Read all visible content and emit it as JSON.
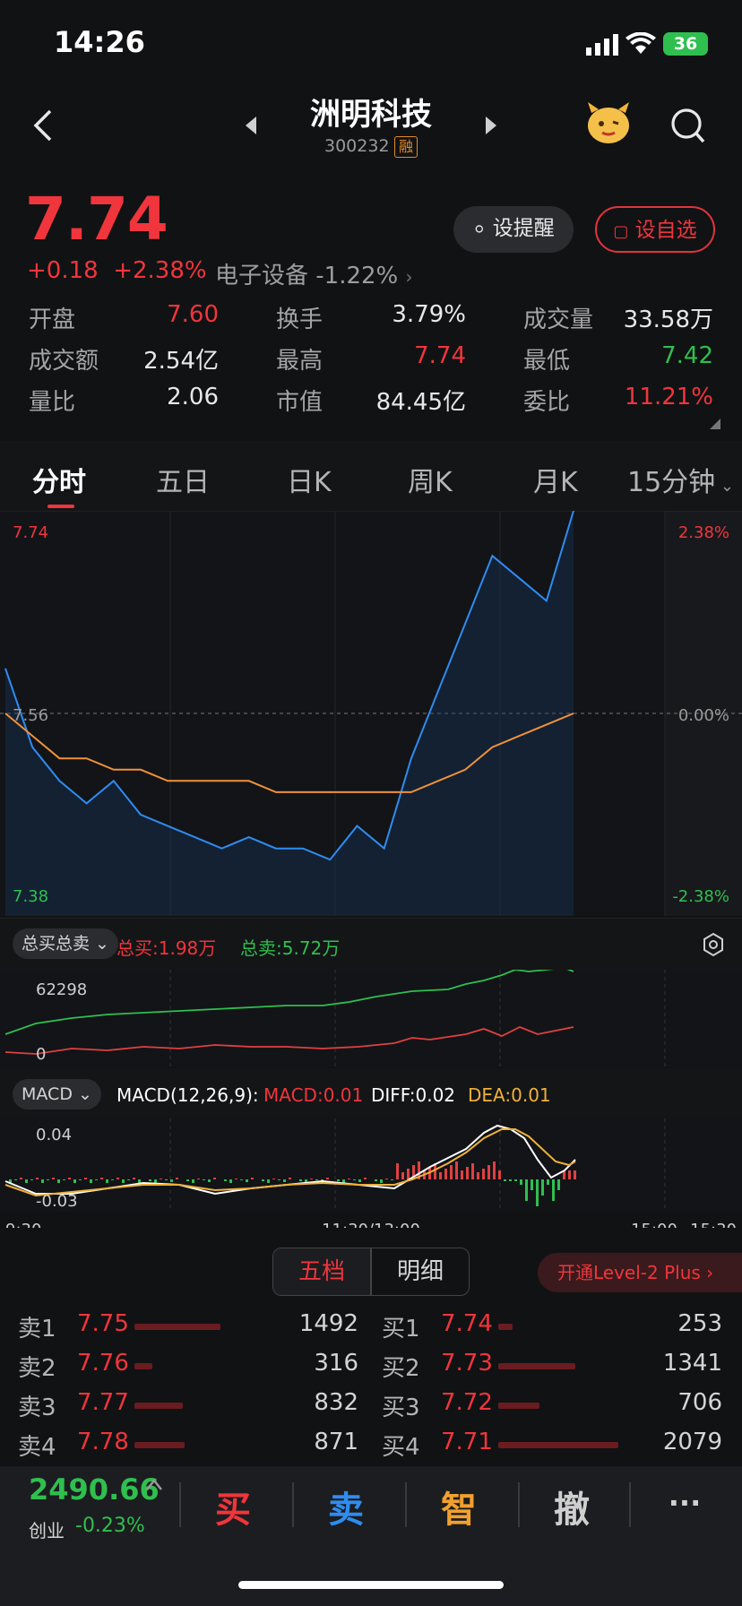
{
  "status": {
    "time": "14:26",
    "battery": "36"
  },
  "header": {
    "name": "洲明科技",
    "code": "300232",
    "badge": "融"
  },
  "quote": {
    "price": "7.74",
    "change": "+0.18",
    "change_pct": "+2.38%",
    "sector": "电子设备 -1.22%",
    "alert_label": "设提醒",
    "watch_label": "设自选"
  },
  "stats": {
    "open_label": "开盘",
    "open": "7.60",
    "turnover_label": "换手",
    "turnover": "3.79%",
    "volume_label": "成交量",
    "volume": "33.58万",
    "amount_label": "成交额",
    "amount": "2.54亿",
    "high_label": "最高",
    "high": "7.74",
    "low_label": "最低",
    "low": "7.42",
    "vol_ratio_label": "量比",
    "vol_ratio": "2.06",
    "mkt_cap_label": "市值",
    "mkt_cap": "84.45亿",
    "bid_ratio_label": "委比",
    "bid_ratio": "11.21%"
  },
  "tabs": [
    "分时",
    "五日",
    "日K",
    "周K",
    "月K",
    "15分钟"
  ],
  "chart": {
    "price_top": "7.74",
    "price_mid": "7.56",
    "price_bottom": "7.38",
    "pct_top": "2.38%",
    "pct_mid": "0.00%",
    "pct_bottom": "-2.38%",
    "bs_chip": "总买总卖",
    "total_buy": "总买:1.98万",
    "total_sell": "总卖:5.72万",
    "bs_top": "62298",
    "bs_bottom": "0",
    "macd_chip": "MACD",
    "macd_params": "MACD(12,26,9):",
    "macd_val": "MACD:0.01",
    "diff_val": "DIFF:0.02",
    "dea_val": "DEA:0.01",
    "macd_top": "0.04",
    "macd_bottom": "-0.03",
    "time_start": "9:30",
    "time_mid": "11:30/13:00",
    "time_1500": "15:00",
    "time_end": "15:30"
  },
  "chart_data": {
    "type": "line",
    "title": "",
    "ylim": [
      7.38,
      7.74
    ],
    "prev_close": 7.56,
    "x": [
      "9:30",
      "9:40",
      "9:50",
      "10:00",
      "10:10",
      "10:20",
      "10:30",
      "10:40",
      "10:50",
      "11:00",
      "11:10",
      "11:20",
      "11:30",
      "13:10",
      "13:20",
      "13:30",
      "13:40",
      "13:50",
      "14:00",
      "14:10",
      "14:20",
      "14:26"
    ],
    "series": [
      {
        "values": [
          7.6,
          7.53,
          7.5,
          7.48,
          7.5,
          7.47,
          7.46,
          7.45,
          7.44,
          7.45,
          7.44,
          7.44,
          7.43,
          7.46,
          7.44,
          7.52,
          7.58,
          7.64,
          7.7,
          7.68,
          7.66,
          7.74
        ]
      },
      {
        "values": [
          7.56,
          7.54,
          7.52,
          7.52,
          7.51,
          7.51,
          7.5,
          7.5,
          7.5,
          7.5,
          7.49,
          7.49,
          7.49,
          7.49,
          7.49,
          7.49,
          7.5,
          7.51,
          7.53,
          7.54,
          7.55,
          7.56
        ]
      }
    ]
  },
  "orderbook": {
    "tab_five": "五档",
    "tab_detail": "明细",
    "level2": "开通Level-2 Plus",
    "sell": [
      {
        "label": "卖1",
        "price": "7.75",
        "vol": "1492"
      },
      {
        "label": "卖2",
        "price": "7.76",
        "vol": "316"
      },
      {
        "label": "卖3",
        "price": "7.77",
        "vol": "832"
      },
      {
        "label": "卖4",
        "price": "7.78",
        "vol": "871"
      }
    ],
    "buy": [
      {
        "label": "买1",
        "price": "7.74",
        "vol": "253"
      },
      {
        "label": "买2",
        "price": "7.73",
        "vol": "1341"
      },
      {
        "label": "买3",
        "price": "7.72",
        "vol": "706"
      },
      {
        "label": "买4",
        "price": "7.71",
        "vol": "2079"
      }
    ]
  },
  "bottom": {
    "index_val": "2490.66",
    "index_name": "创业",
    "index_chg": "-0.23%",
    "buy": "买",
    "sell": "卖",
    "smart": "智",
    "cancel": "撤",
    "more": "···"
  }
}
